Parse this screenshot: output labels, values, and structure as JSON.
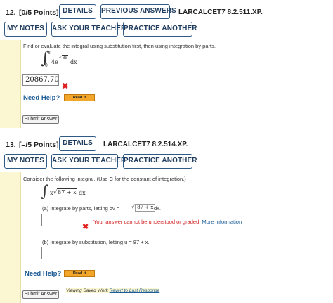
{
  "q12": {
    "number": "12.",
    "points": "[0/5 Points]",
    "details_label": "DETAILS",
    "previous_answers_label": "PREVIOUS ANSWERS",
    "code": "LARCALCET7 8.2.511.XP.",
    "my_notes_label": "MY NOTES",
    "ask_teacher_label": "ASK YOUR TEACHER",
    "practice_label": "PRACTICE ANOTHER",
    "prompt": "Find or evaluate the integral using substitution first, then using integration by parts.",
    "upper_limit": "8",
    "lower_limit": "0",
    "integrand_coef": "4e",
    "integrand_sqrt": "8x",
    "dx": "dx",
    "answer_value": "20867.70",
    "need_help_label": "Need Help?",
    "read_it_label": "Read It",
    "submit_label": "Submit Answer"
  },
  "q13": {
    "number": "13.",
    "points": "[–/5 Points]",
    "details_label": "DETAILS",
    "code": "LARCALCET7 8.2.514.XP.",
    "my_notes_label": "MY NOTES",
    "ask_teacher_label": "ASK YOUR TEACHER",
    "practice_label": "PRACTICE ANOTHER",
    "prompt": "Consider the following integral. (Use C for the constant of integration.)",
    "integrand_x": "x",
    "integrand_sqrt": "87 + x",
    "dx": "dx",
    "part_a": "(a) Integrate by parts, letting dv =",
    "part_a_sqrt": "87 + x",
    "part_a_dx": "dx.",
    "error_text": "Your answer cannot be understood or graded.",
    "more_info": "More Information",
    "part_b": "(b) Integrate by substitution, letting u = 87 + x.",
    "need_help_label": "Need Help?",
    "read_it_label": "Read It",
    "submit_label": "Submit Answer",
    "viewing_prefix": "Viewing Saved Work",
    "revert_link": "Revert to Last Response"
  },
  "colors": {
    "button_border": "#2f5a86",
    "button_text": "#1f3c5e",
    "error_red": "#e02020",
    "help_blue": "#1c5c96",
    "read_it_orange": "#f2a62a",
    "side_bar_yellow": "#fbf7d3"
  },
  "icons": {
    "wrong_mark": "x-mark-icon"
  }
}
